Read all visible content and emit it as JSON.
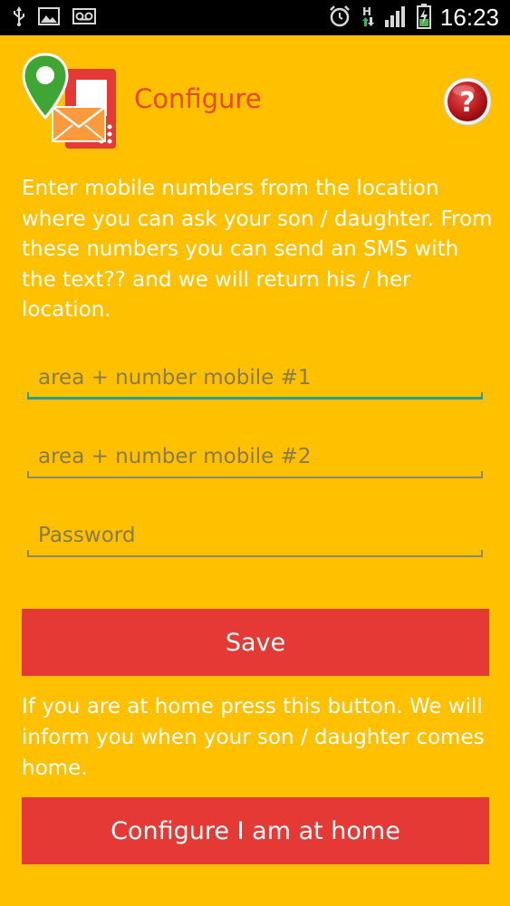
{
  "status_bar": {
    "time": "16:23",
    "icons": [
      "usb-icon",
      "image-icon",
      "voicemail-icon",
      "alarm-icon",
      "network-h-icon",
      "signal-icon",
      "battery-charging-icon"
    ],
    "network_type": "H"
  },
  "header": {
    "title": "Configure",
    "help_label": "?"
  },
  "intro": {
    "text": "Enter mobile numbers from the location where you can ask your son / daughter. From these numbers you can send an SMS with the text?? and we will return his / her location."
  },
  "form": {
    "mobile1_placeholder": "area + number mobile #1",
    "mobile1_value": "",
    "mobile2_placeholder": "area + number mobile #2",
    "mobile2_value": "",
    "password_placeholder": "Password",
    "password_value": ""
  },
  "save_button": {
    "label": "Save"
  },
  "home": {
    "text": "If you are at home press this button. We will inform you when your son / daughter comes home.",
    "button_label": "Configure I am at home"
  },
  "colors": {
    "background": "#FFC000",
    "title": "#E64A19",
    "button": "#E53935",
    "active_underline": "#2D9D91",
    "status_bar": "#000000"
  }
}
